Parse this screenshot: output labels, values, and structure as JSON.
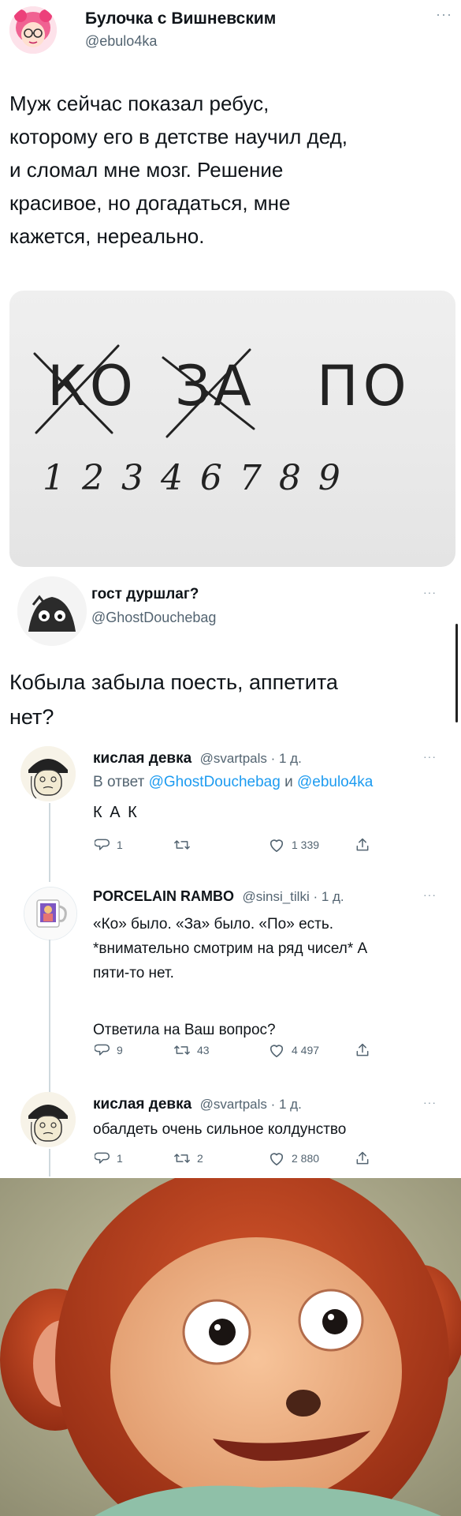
{
  "main_tweet": {
    "author_name": "Булочка с Вишневским",
    "handle": "@ebulo4ka",
    "more": "···",
    "text_lines": [
      "Муж сейчас показал ребус,",
      "которому его в детстве научил дед,",
      "и сломал мне мозг. Решение",
      "красивое, но догадаться, мне",
      "кажется, нереально."
    ],
    "image": {
      "words": [
        "КО",
        "ЗА",
        "ПО"
      ],
      "digits": "1 2 3 4 6 7 8 9"
    }
  },
  "reply1": {
    "author_name": "гост дуршлаг?",
    "handle": "@GhostDouchebag",
    "more": "···",
    "text_lines": [
      "Кобыла забыла поесть, аппетита",
      "нет?"
    ]
  },
  "reply2": {
    "author_name": "кислая девка",
    "meta": "@svartpals · 1 д.",
    "more": "···",
    "reply_to_prefix": "В ответ",
    "reply_to_user1": "@GhostDouchebag",
    "reply_to_and": "и",
    "reply_to_user2": "@ebulo4ka",
    "text": "К А К",
    "actions": {
      "replies": "1",
      "retweets": "",
      "likes": "1 339"
    }
  },
  "reply3": {
    "author_name": "PORCELAIN RAMBO",
    "meta": "@sinsi_tilki · 1 д.",
    "more": "···",
    "text_lines": [
      "«Ко» было. «За» было. «По» есть.",
      "*внимательно смотрим на ряд чисел* А",
      "пяти-то нет.",
      "",
      "Ответила на Ваш вопрос?"
    ],
    "actions": {
      "replies": "9",
      "retweets": "43",
      "likes": "4 497"
    }
  },
  "reply4": {
    "author_name": "кислая девка",
    "meta": "@svartpals · 1 д.",
    "more": "···",
    "text": "обалдеть очень сильное колдунство",
    "actions": {
      "replies": "1",
      "retweets": "2",
      "likes": "2 880"
    }
  },
  "colors": {
    "link": "#1d9bf0",
    "text": "#0f1419",
    "secondary": "#536471",
    "divider": "#cfd9de"
  }
}
